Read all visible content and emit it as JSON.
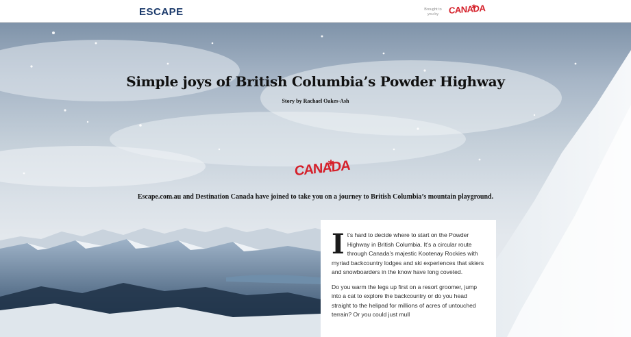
{
  "header": {
    "logo": "ESCAPE",
    "sponsor_line1": "Brought to",
    "sponsor_line2": "you by",
    "sponsor_brand": "CANADA"
  },
  "article": {
    "title": "Simple joys of British Columbia’s Powder Highway",
    "byline_prefix": "Story by",
    "byline_author": "Rachael Oakes-Ash",
    "partner_logo": "CANADA",
    "intro": "Escape.com.au and Destination Canada have joined to take you on a journey to British Columbia’s mountain playground.",
    "dropcap": "I",
    "paragraph1": "t’s hard to decide where to start on the Powder Highway in British Columbia. It’s a circular route through Canada’s majestic Kootenay Rockies with myriad backcountry lodges and ski experiences that skiers and snowboarders in the know have long coveted.",
    "paragraph2": "Do you warm the legs up first on a resort groomer, jump into a cat to explore the backcountry or do you head straight to the helipad for millions of acres of untouched terrain? Or you could just mull"
  },
  "colors": {
    "brand_navy": "#1b3a6b",
    "canada_red": "#d5202a"
  },
  "icons": [
    "maple-leaf-icon"
  ]
}
